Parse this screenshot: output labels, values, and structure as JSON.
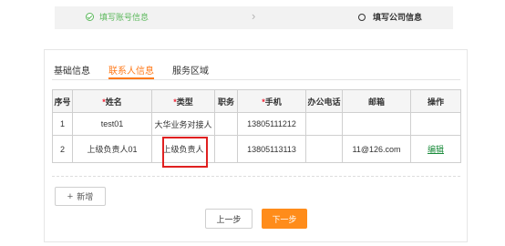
{
  "steps": {
    "step1_label": "填写账号信息",
    "step2_label": "填写公司信息"
  },
  "tabs": [
    {
      "label": "基础信息"
    },
    {
      "label": "联系人信息"
    },
    {
      "label": "服务区域"
    }
  ],
  "active_tab": 1,
  "table": {
    "headers": {
      "seq": "序号",
      "name_req": "*",
      "name": "姓名",
      "type_req": "*",
      "type": "类型",
      "position": "职务",
      "mobile_req": "*",
      "mobile": "手机",
      "office_phone": "办公电话",
      "email": "邮箱",
      "action": "操作"
    },
    "rows": [
      {
        "seq": "1",
        "name": "test01",
        "type": "大华业务对接人",
        "position": "",
        "mobile": "13805111212",
        "office_phone": "",
        "email": "",
        "action": ""
      },
      {
        "seq": "2",
        "name": "上级负责人01",
        "type": "上级负责人",
        "position": "",
        "mobile": "13805113113",
        "office_phone": "",
        "email": "11@126.com",
        "action": "编辑"
      }
    ]
  },
  "buttons": {
    "add_label": "新增",
    "prev_label": "上一步",
    "next_label": "下一步"
  },
  "colors": {
    "accent": "#ff8c1a",
    "success": "#5cb85c",
    "highlight": "#e02020"
  }
}
